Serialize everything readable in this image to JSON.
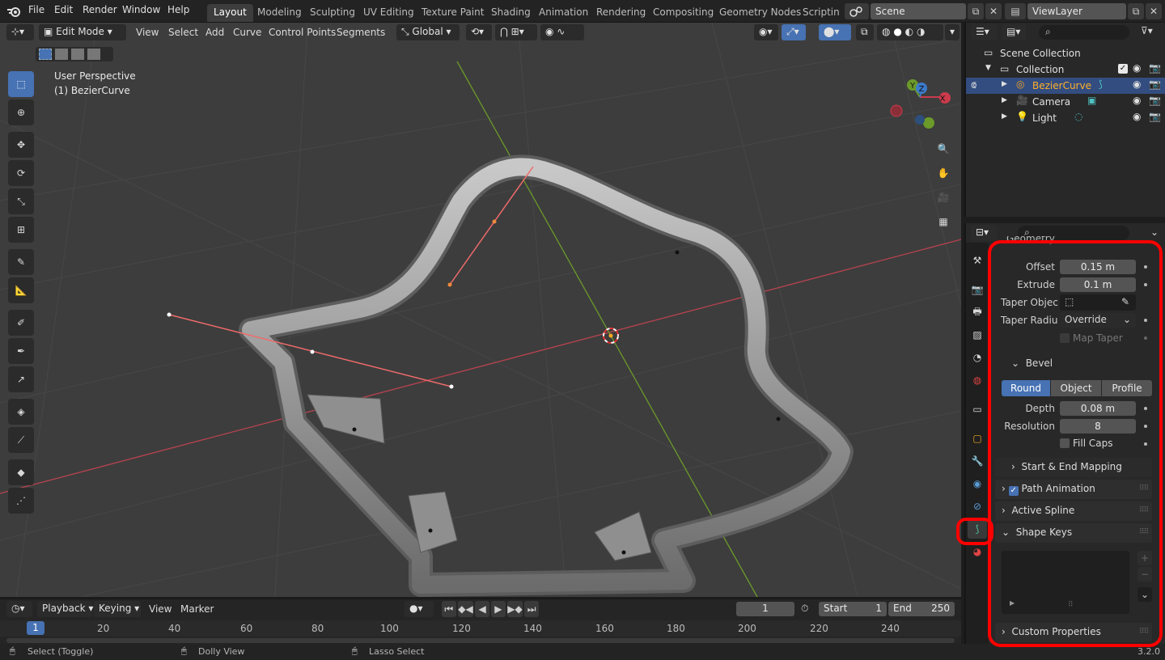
{
  "topbar": {
    "menus": [
      "File",
      "Edit",
      "Render",
      "Window",
      "Help"
    ],
    "workspaces": [
      "Layout",
      "Modeling",
      "Sculpting",
      "UV Editing",
      "Texture Paint",
      "Shading",
      "Animation",
      "Rendering",
      "Compositing",
      "Geometry Nodes",
      "Scripting"
    ],
    "active_workspace": "Layout",
    "scene": "Scene",
    "view_layer": "ViewLayer"
  },
  "viewport": {
    "mode": "Edit Mode",
    "menus": [
      "View",
      "Select",
      "Add",
      "Curve",
      "Control Points",
      "Segments"
    ],
    "orientation": "Global",
    "overlay_line1": "User Perspective",
    "overlay_line2": "(1) BezierCurve",
    "gizmo_axes": {
      "x": "X",
      "y": "Y",
      "z": "Z"
    }
  },
  "timeline": {
    "menus": [
      "Playback",
      "Keying",
      "View",
      "Marker"
    ],
    "current_frame": "1",
    "start_label": "Start",
    "start": "1",
    "end_label": "End",
    "end": "250",
    "ruler": [
      "1",
      "20",
      "40",
      "60",
      "80",
      "100",
      "120",
      "140",
      "160",
      "180",
      "200",
      "220",
      "240"
    ]
  },
  "statusbar": {
    "left": "Select (Toggle)",
    "middle": "Dolly View",
    "right": "Lasso Select",
    "version": "3.2.0"
  },
  "outliner": {
    "root": "Scene Collection",
    "collection": "Collection",
    "items": [
      {
        "name": "BezierCurve",
        "selected": true
      },
      {
        "name": "Camera",
        "selected": false
      },
      {
        "name": "Light",
        "selected": false
      }
    ]
  },
  "properties": {
    "section_partial": "Geometry",
    "offset_label": "Offset",
    "offset": "0.15 m",
    "extrude_label": "Extrude",
    "extrude": "0.1 m",
    "taper_object_label": "Taper Objec",
    "taper_radius_label": "Taper Radiu",
    "taper_radius": "Override",
    "map_taper": "Map Taper",
    "bevel": {
      "title": "Bevel",
      "modes": [
        "Round",
        "Object",
        "Profile"
      ],
      "active_mode": "Round",
      "depth_label": "Depth",
      "depth": "0.08 m",
      "resolution_label": "Resolution",
      "resolution": "8",
      "fill_caps": "Fill Caps"
    },
    "panels": {
      "start_end": "Start & End Mapping",
      "path_animation": "Path Animation",
      "active_spline": "Active Spline",
      "shape_keys": "Shape Keys",
      "custom_properties": "Custom Properties"
    }
  },
  "colors": {
    "accent": "#4772b3",
    "highlight": "#ff0000",
    "selected_text": "#ffaf29",
    "x_axis": "#cc3b4c",
    "y_axis": "#6b9a2a",
    "viewport_bg": "#3d3d3d"
  }
}
